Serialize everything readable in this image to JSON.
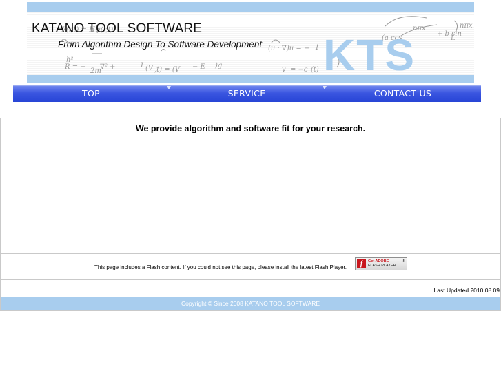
{
  "header": {
    "title": "KATANO TOOL SOFTWARE",
    "tagline": "From Algorithm Design To Software Development",
    "logo_text": "KTS",
    "accent_color": "#a8cdee"
  },
  "nav": {
    "items": [
      {
        "label": "TOP"
      },
      {
        "label": "SERVICE"
      },
      {
        "label": "CONTACT US"
      }
    ],
    "color": "#2845d6"
  },
  "main": {
    "headline": "We provide algorithm and software fit for your research.",
    "flash_notice": "This page includes a Flash content. If you could not see this page, please install the latest Flash Player.",
    "flash_badge": {
      "line1": "Get ADOBE",
      "line2": "FLASH PLAYER",
      "icon": "flash-player-icon"
    }
  },
  "status": {
    "last_updated": "Last Updated 2010.08.09"
  },
  "footer": {
    "copyright": "Copyright © Since 2008 KATANO TOOL SOFTWARE"
  }
}
